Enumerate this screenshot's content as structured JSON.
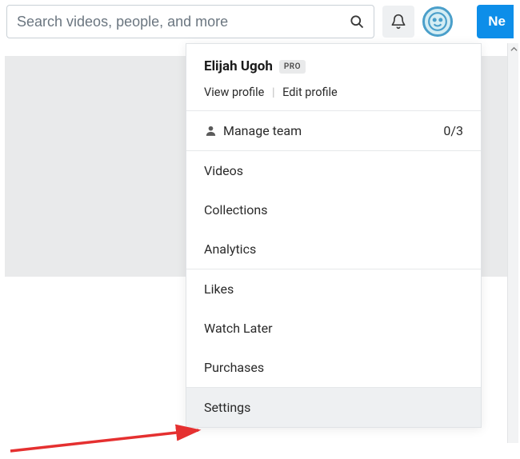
{
  "search": {
    "placeholder": "Search videos, people, and more"
  },
  "topbar": {
    "new_label": "Ne"
  },
  "dropdown": {
    "user_name": "Elijah Ugoh",
    "badge": "PRO",
    "view_profile": "View profile",
    "edit_profile": "Edit profile",
    "manage_team": {
      "label": "Manage team",
      "count": "0/3"
    },
    "items": [
      {
        "label": "Videos"
      },
      {
        "label": "Collections"
      },
      {
        "label": "Analytics"
      },
      {
        "label": "Likes"
      },
      {
        "label": "Watch Later"
      },
      {
        "label": "Purchases"
      },
      {
        "label": "Settings",
        "hovered": true
      }
    ]
  }
}
